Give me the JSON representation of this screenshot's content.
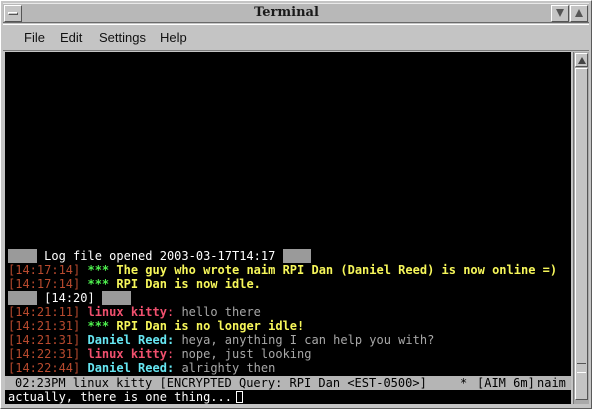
{
  "window": {
    "title": "Terminal"
  },
  "menu": {
    "file": "File",
    "edit": "Edit",
    "settings": "Settings",
    "help": "Help"
  },
  "log": {
    "opened": "Log file opened 2003-03-17T14:17",
    "l1": {
      "ts": "[14:17:14]",
      "stars": "***",
      "text": "The guy who wrote naim RPI Dan (Daniel Reed) is now online =)"
    },
    "l2": {
      "ts": "[14:17:14]",
      "stars": "***",
      "text": "RPI Dan is now idle."
    },
    "time_marker": "[14:20]",
    "l3": {
      "ts": "[14:21:11]",
      "nick": "linux kitty",
      "sep": ":",
      "text": "hello there"
    },
    "l4": {
      "ts": "[14:21:31]",
      "stars": "***",
      "text": "RPI Dan is no longer idle!"
    },
    "l5": {
      "ts": "[14:21:31]",
      "nick": "Daniel Reed",
      "sep": ":",
      "text": "heya, anything I can help you with?"
    },
    "l6": {
      "ts": "[14:22:31]",
      "nick": "linux kitty",
      "sep": ":",
      "text": "nope, just looking"
    },
    "l7": {
      "ts": "[14:22:44]",
      "nick": "Daniel Reed",
      "sep": ":",
      "text": "alrighty then"
    }
  },
  "status": {
    "left": "02:23PM linux kitty [ENCRYPTED Query: RPI Dan <EST-0500>]",
    "star": "*",
    "aim": "[AIM 6m]",
    "app": "naim"
  },
  "input": {
    "value": "actually, there is one thing..."
  },
  "colors": {
    "timestamp": "#b84a2e",
    "system": "#4ef04e",
    "system_text": "#f6f65a",
    "nick_self": "#f0506e",
    "nick_peer": "#66e6f2"
  }
}
